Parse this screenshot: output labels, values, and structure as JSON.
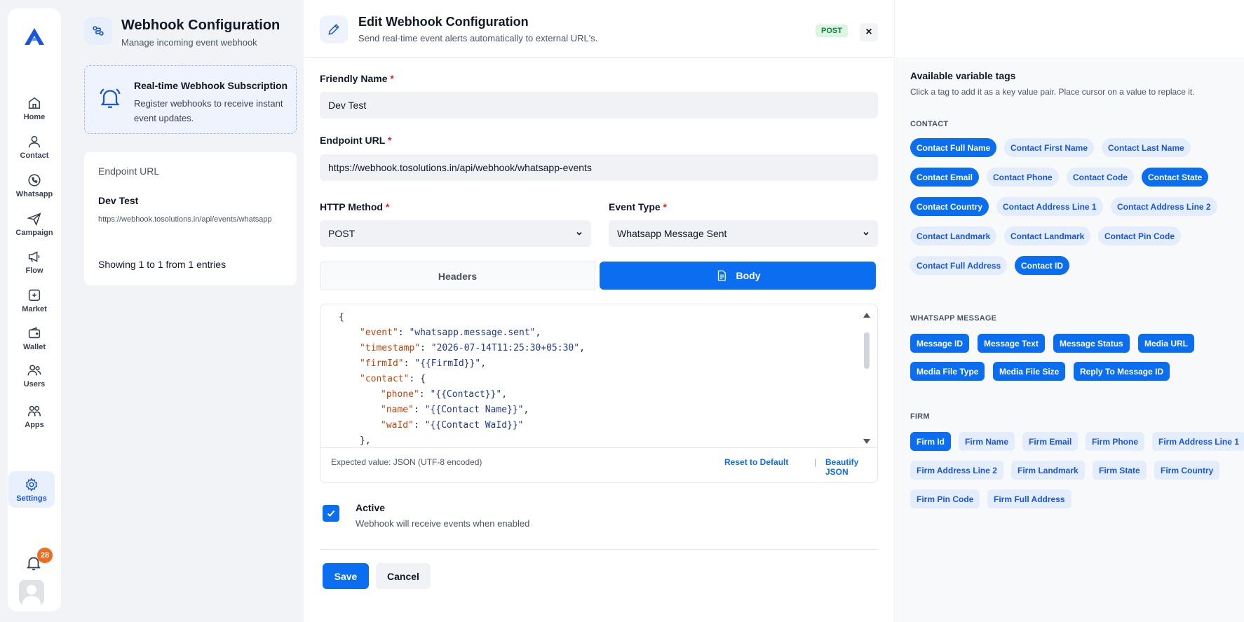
{
  "sidebar": {
    "items": [
      {
        "label": "Home",
        "icon": "home-icon"
      },
      {
        "label": "Contact",
        "icon": "user-icon"
      },
      {
        "label": "Whatsapp",
        "icon": "whatsapp-icon"
      },
      {
        "label": "Campaign",
        "icon": "send-icon"
      },
      {
        "label": "Flow",
        "icon": "megaphone-icon"
      },
      {
        "label": "Market",
        "icon": "market-icon"
      },
      {
        "label": "Wallet",
        "icon": "wallet-icon"
      },
      {
        "label": "Users",
        "icon": "users-icon"
      },
      {
        "label": "Apps",
        "icon": "apps-icon"
      },
      {
        "label": "Settings",
        "icon": "gear-icon"
      }
    ],
    "active": "Settings",
    "notification_count": "28"
  },
  "left_panel": {
    "title": "Webhook Configuration",
    "subtitle": "Manage incoming event webhook",
    "subscription": {
      "title": "Real-time Webhook Subscription",
      "description": "Register webhooks to receive instant event updates."
    },
    "endpoint_card": {
      "label": "Endpoint URL",
      "name": "Dev Test",
      "url": "https://webhook.tosolutions.in/api/events/whatsapp",
      "count": "Showing 1 to 1 from 1 entries"
    }
  },
  "modal": {
    "title": "Edit Webhook Configuration",
    "subtitle": "Send real-time event alerts automatically to external URL's.",
    "method_badge": "POST",
    "close_glyph": "×",
    "friendly_name": {
      "label": "Friendly Name",
      "value": "Dev Test"
    },
    "endpoint_url": {
      "label": "Endpoint URL",
      "value": "https://webhook.tosolutions.in/api/webhook/whatsapp-events"
    },
    "http_method": {
      "label": "HTTP Method",
      "value": "POST"
    },
    "event_type": {
      "label": "Event Type",
      "value": "Whatsapp Message Sent"
    },
    "required_mark": "*",
    "tabs": {
      "headers": "Headers",
      "body": "Body",
      "active": "Body"
    },
    "editor": {
      "lines": [
        {
          "indent": 0,
          "text": "{"
        },
        {
          "indent": 1,
          "key": "\"event\"",
          "sep": ": ",
          "value": "\"whatsapp.message.sent\"",
          "end": ","
        },
        {
          "indent": 1,
          "key": "\"timestamp\"",
          "sep": ": ",
          "value": "\"2026-07-14T11:25:30+05:30\"",
          "end": ","
        },
        {
          "indent": 1,
          "key": "\"firmId\"",
          "sep": ": ",
          "value": "\"{{FirmId}}\"",
          "end": ","
        },
        {
          "indent": 1,
          "key": "\"contact\"",
          "sep": ": ",
          "value": "",
          "end": "{"
        },
        {
          "indent": 2,
          "key": "\"phone\"",
          "sep": ": ",
          "value": "\"{{Contact}}\"",
          "end": ","
        },
        {
          "indent": 2,
          "key": "\"name\"",
          "sep": ": ",
          "value": "\"{{Contact Name}}\"",
          "end": ","
        },
        {
          "indent": 2,
          "key": "\"waId\"",
          "sep": ": ",
          "value": "\"{{Contact WaId}}\"",
          "end": ""
        },
        {
          "indent": 1,
          "text": "},"
        }
      ],
      "expected": "Expected value: JSON (UTF-8 encoded)",
      "reset": "Reset to Default",
      "separator": "|",
      "beautify": "Beautify JSON"
    },
    "active": {
      "checked": true,
      "label": "Active",
      "description": "Webhook will receive events when enabled"
    },
    "save": "Save",
    "cancel": "Cancel"
  },
  "variables": {
    "title": "Available variable tags",
    "description": "Click a tag to add it as a key value pair. Place cursor on a value to replace it.",
    "groups": [
      {
        "label": "CONTACT",
        "tags": [
          {
            "label": "Contact Full Name",
            "on": true
          },
          {
            "label": "Contact First Name",
            "on": false
          },
          {
            "label": "Contact Last Name",
            "on": false
          },
          {
            "label": "Contact Email",
            "on": true
          },
          {
            "label": "Contact Phone",
            "on": false
          },
          {
            "label": "Contact Code",
            "on": false
          },
          {
            "label": "Contact State",
            "on": true
          },
          {
            "label": "Contact Country",
            "on": true
          },
          {
            "label": "Contact Address Line 1",
            "on": false
          },
          {
            "label": "Contact Address Line 2",
            "on": false
          },
          {
            "label": "Contact Landmark",
            "on": false
          },
          {
            "label": "Contact Landmark",
            "on": false
          },
          {
            "label": "Contact Pin Code",
            "on": false
          },
          {
            "label": "Contact Full Address",
            "on": false
          },
          {
            "label": "Contact ID",
            "on": true
          }
        ]
      },
      {
        "label": "WHATSAPP MESSAGE",
        "tags": [
          {
            "label": "Message ID",
            "on": true
          },
          {
            "label": "Message Text",
            "on": true
          },
          {
            "label": "Message Status",
            "on": true
          },
          {
            "label": "Media URL",
            "on": true
          },
          {
            "label": "Media File Type",
            "on": true
          },
          {
            "label": "Media File Size",
            "on": true
          },
          {
            "label": "Reply To Message ID",
            "on": true
          }
        ]
      },
      {
        "label": "FIRM",
        "tags": [
          {
            "label": "Firm Id",
            "on": true
          },
          {
            "label": "Firm Name",
            "on": false
          },
          {
            "label": "Firm Email",
            "on": false
          },
          {
            "label": "Firm Phone",
            "on": false
          },
          {
            "label": "Firm Address Line 1",
            "on": false
          },
          {
            "label": "Firm Address Line 2",
            "on": false
          },
          {
            "label": "Firm Landmark",
            "on": false
          },
          {
            "label": "Firm State",
            "on": false
          },
          {
            "label": "Firm Country",
            "on": false
          },
          {
            "label": "Firm Pin Code",
            "on": false
          },
          {
            "label": "Firm Full Address",
            "on": false
          }
        ]
      }
    ]
  },
  "colors": {
    "accent": "#0b6ef0",
    "accent_soft": "#e4edfc",
    "badge": "#f26a1b",
    "post_badge_bg": "#dcf5e3",
    "post_badge_fg": "#15803d"
  }
}
